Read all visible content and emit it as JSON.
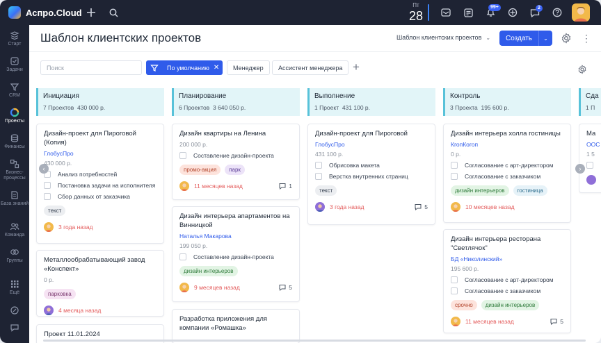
{
  "app": {
    "name": "Аспро.Cloud"
  },
  "topbar": {
    "date_dow": "Пт",
    "date_day": "28",
    "notif_badge": "99+",
    "chat_badge": "2"
  },
  "sidebar": {
    "items": [
      {
        "label": "Старт",
        "icon": "layers-icon"
      },
      {
        "label": "Задачи",
        "icon": "tasks-icon"
      },
      {
        "label": "CRM",
        "icon": "crm-icon"
      },
      {
        "label": "Проекты",
        "icon": "projects-icon"
      },
      {
        "label": "Финансы",
        "icon": "finance-icon"
      },
      {
        "label": "Бизнес-процессы",
        "icon": "process-icon"
      },
      {
        "label": "База знаний",
        "icon": "knowledge-icon"
      },
      {
        "label": "Команда",
        "icon": "team-icon"
      },
      {
        "label": "Группы",
        "icon": "groups-icon"
      },
      {
        "label": "Ещё",
        "icon": "grid-icon"
      }
    ],
    "active": "Проекты"
  },
  "header": {
    "title": "Шаблон клиентских проектов",
    "template_select": "Шаблон клиентских проектов",
    "create_label": "Создать"
  },
  "filters": {
    "search_placeholder": "Поиск",
    "active_filter": "По умолчанию",
    "chips": [
      "Менеджер",
      "Ассистент менеджера"
    ]
  },
  "columns": [
    {
      "name": "Инициация",
      "count": "7 Проектов",
      "sum": "430 000 р.",
      "cards": [
        {
          "title": "Дизайн-проект для Пироговой (Копия)",
          "client": "ГлобусПро",
          "price": "430 000 р.",
          "tasks": [
            "Анализ потребностей",
            "Постановка задачи на исполнителя",
            "Сбор данных от заказчика"
          ],
          "tags": [
            {
              "text": "текст",
              "kind": "grey"
            }
          ],
          "ago": "3 года назад"
        },
        {
          "title": "Металлообрабатывающий завод «Конспект»",
          "price": "0 р.",
          "tags": [
            {
              "text": "парковка",
              "kind": "pink"
            }
          ],
          "ago": "4 месяца назад"
        },
        {
          "title": "Проект 11.01.2024"
        }
      ]
    },
    {
      "name": "Планирование",
      "count": "6 Проектов",
      "sum": "3 640 050 р.",
      "cards": [
        {
          "title": "Дизайн квартиры на Ленина",
          "price": "200 000 р.",
          "tasks": [
            "Составление дизайн-проекта"
          ],
          "tags": [
            {
              "text": "промо-акция",
              "kind": "salmon"
            },
            {
              "text": "парк",
              "kind": "lilac"
            }
          ],
          "ago": "11 месяцев назад",
          "comments": "1"
        },
        {
          "title": "Дизайн интерьера апартаментов на Винницкой",
          "client": "Наталья Макарова",
          "price": "199 050 р.",
          "tasks": [
            "Составление дизайн-проекта"
          ],
          "tags": [
            {
              "text": "дизайн интерьеров",
              "kind": "green"
            }
          ],
          "ago": "9 месяцев назад",
          "comments": "5"
        },
        {
          "title": "Разработка приложения для компании «Ромашка»"
        }
      ]
    },
    {
      "name": "Выполнение",
      "count": "1 Проект",
      "sum": "431 100 р.",
      "cards": [
        {
          "title": "Дизайн-проект для Пироговой",
          "client": "ГлобусПро",
          "price": "431 100 р.",
          "tasks": [
            "Обрисовка макета",
            "Верстка внутренних страниц"
          ],
          "tags": [
            {
              "text": "текст",
              "kind": "grey"
            }
          ],
          "ago": "3 года назад",
          "comments": "5"
        }
      ]
    },
    {
      "name": "Контроль",
      "count": "3 Проекта",
      "sum": "195 600 р.",
      "cards": [
        {
          "title": "Дизайн интерьера холла гостиницы",
          "client": "КгопКогоп",
          "price": "0 р.",
          "tasks": [
            "Согласование с арт-директором",
            "Согласование с заказчиком"
          ],
          "tags": [
            {
              "text": "дизайн интерьеров",
              "kind": "green"
            },
            {
              "text": "гостиница",
              "kind": "ice"
            }
          ],
          "ago": "10 месяцев назад"
        },
        {
          "title": "Дизайн интерьера ресторана \"Светлячок\"",
          "client": "БД «Николинский»",
          "price": "195 600 р.",
          "tasks": [
            "Согласование с арт-директором",
            "Согласование с заказчиком"
          ],
          "tags": [
            {
              "text": "срочно",
              "kind": "salmon"
            },
            {
              "text": "дизайн интерьеров",
              "kind": "green"
            }
          ],
          "ago": "11 месяцев назад",
          "comments": "5"
        }
      ]
    },
    {
      "name": "Сда",
      "count": "1 П",
      "cards": [
        {
          "title": "Ма",
          "client": "ООС",
          "price": "1 5"
        }
      ]
    }
  ],
  "colors": {
    "accent": "#2f5bea",
    "topbar": "#1e2333",
    "column_head": "#e2f5f8",
    "overdue": "#e35a5a"
  }
}
